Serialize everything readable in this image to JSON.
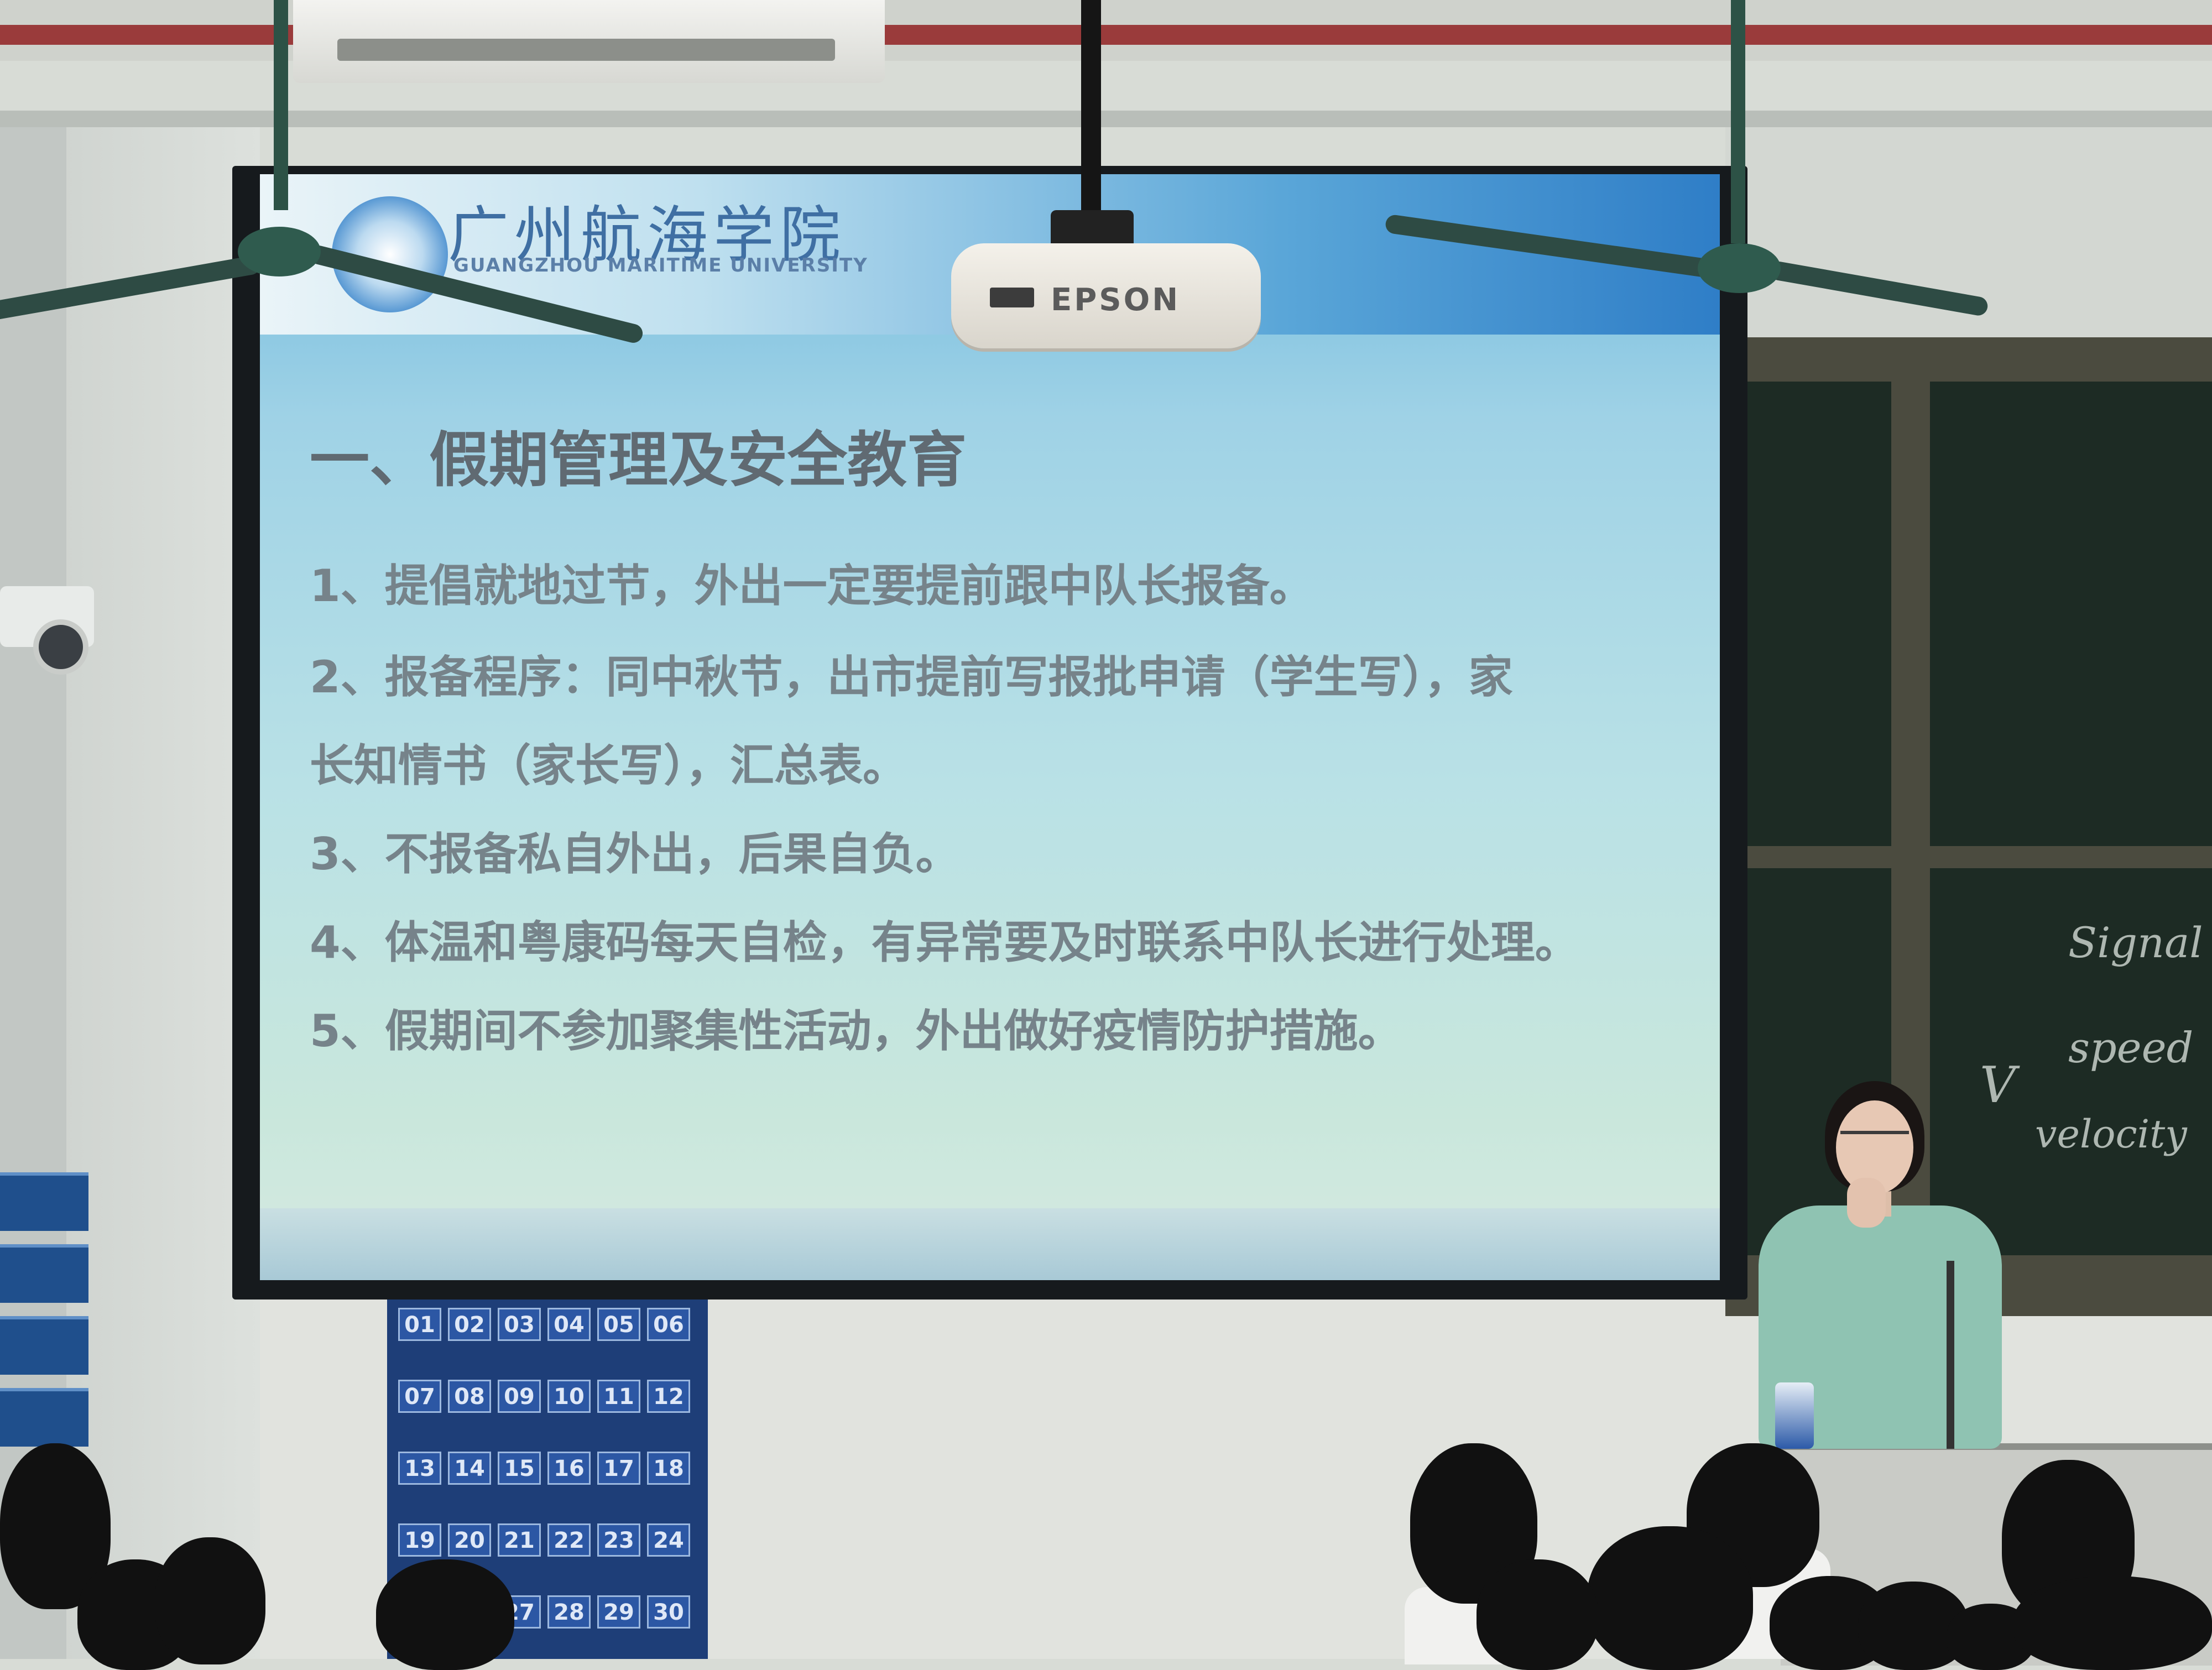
{
  "slide": {
    "logo": {
      "name_cn": "广州航海学院",
      "name_en": "GUANGZHOU MARITIME UNIVERSITY"
    },
    "title": "一、假期管理及安全教育",
    "lines": [
      "1、提倡就地过节，外出一定要提前跟中队长报备。",
      "2、报备程序：同中秋节，出市提前写报批申请（学生写），家",
      "长知情书（家长写），汇总表。",
      "3、不报备私自外出，后果自负。",
      "4、体温和粤康码每天自检，有异常要及时联系中队长进行处理。",
      "5、假期间不参加聚集性活动，外出做好疫情防护措施。"
    ]
  },
  "projector": {
    "brand": "EPSON"
  },
  "chalkboard": {
    "words": [
      "Signal",
      "speed",
      "velocity"
    ],
    "letter": "V"
  },
  "calendar_board": {
    "numbers": [
      "01",
      "02",
      "03",
      "04",
      "05",
      "06",
      "07",
      "08",
      "09",
      "10",
      "11",
      "12",
      "13",
      "14",
      "15",
      "16",
      "17",
      "18",
      "19",
      "20",
      "21",
      "22",
      "23",
      "24",
      "27",
      "28",
      "29",
      "30"
    ]
  },
  "colors": {
    "screen_top": "#6fb9dd",
    "screen_bottom": "#d6e9e1",
    "slide_text": "#76838a",
    "chalkboard": "#1d2b24",
    "calendar_board": "#1e3e78"
  }
}
